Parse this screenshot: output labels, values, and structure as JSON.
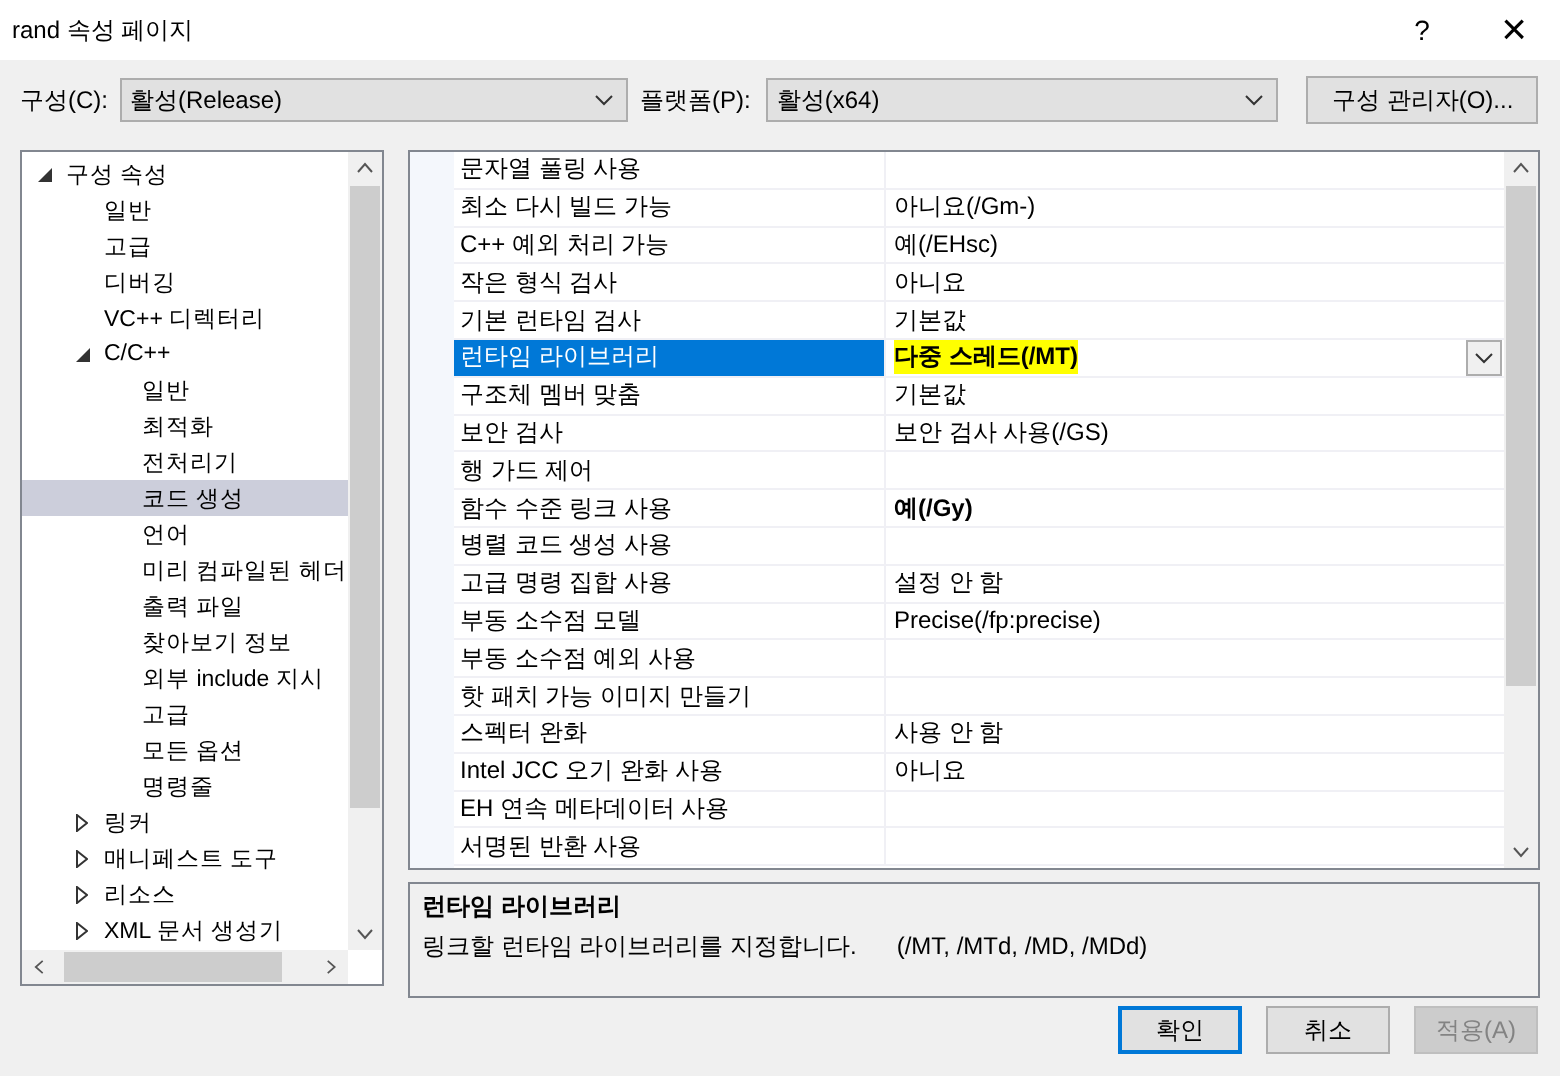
{
  "window": {
    "title": "rand 속성 페이지",
    "help": "?",
    "close": "×"
  },
  "toolbar": {
    "config_label": "구성(C):",
    "config_value": "활성(Release)",
    "platform_label": "플랫폼(P):",
    "platform_value": "활성(x64)",
    "manager_button": "구성 관리자(O)..."
  },
  "tree": [
    {
      "label": "구성 속성",
      "expanded": true,
      "selected": false,
      "children": [
        {
          "label": "일반",
          "selected": false
        },
        {
          "label": "고급",
          "selected": false
        },
        {
          "label": "디버깅",
          "selected": false
        },
        {
          "label": "VC++ 디렉터리",
          "selected": false
        },
        {
          "label": "C/C++",
          "expanded": true,
          "selected": false,
          "children": [
            {
              "label": "일반",
              "selected": false
            },
            {
              "label": "최적화",
              "selected": false
            },
            {
              "label": "전처리기",
              "selected": false
            },
            {
              "label": "코드 생성",
              "selected": true
            },
            {
              "label": "언어",
              "selected": false
            },
            {
              "label": "미리 컴파일된 헤더",
              "selected": false
            },
            {
              "label": "출력 파일",
              "selected": false
            },
            {
              "label": "찾아보기 정보",
              "selected": false
            },
            {
              "label": "외부 include 지시",
              "selected": false
            },
            {
              "label": "고급",
              "selected": false
            },
            {
              "label": "모든 옵션",
              "selected": false
            },
            {
              "label": "명령줄",
              "selected": false
            }
          ]
        },
        {
          "label": "링커",
          "expanded": false,
          "selected": false
        },
        {
          "label": "매니페스트 도구",
          "expanded": false,
          "selected": false
        },
        {
          "label": "리소스",
          "expanded": false,
          "selected": false
        },
        {
          "label": "XML 문서 생성기",
          "expanded": false,
          "selected": false
        }
      ]
    }
  ],
  "properties": [
    {
      "name": "문자열 풀링 사용",
      "selected": false
    },
    {
      "name": "최소 다시 빌드 가능",
      "value": "아니요(/Gm-)",
      "selected": false,
      "modified": false
    },
    {
      "name": "C++ 예외 처리 가능",
      "value": "예(/EHsc)",
      "selected": false,
      "modified": false
    },
    {
      "name": "작은 형식 검사",
      "value": "아니요",
      "selected": false,
      "modified": false
    },
    {
      "name": "기본 런타임 검사",
      "value": "기본값",
      "selected": false,
      "modified": false
    },
    {
      "name": "런타임 라이브러리",
      "value": "다중 스레드(/MT)",
      "selected": true,
      "modified": true,
      "highlighted": true
    },
    {
      "name": "구조체 멤버 맞춤",
      "value": "기본값",
      "selected": false,
      "modified": false
    },
    {
      "name": "보안 검사",
      "value": "보안 검사 사용(/GS)",
      "selected": false,
      "modified": false
    },
    {
      "name": "행 가드 제어",
      "selected": false
    },
    {
      "name": "함수 수준 링크 사용",
      "value": "예(/Gy)",
      "selected": false,
      "modified": true
    },
    {
      "name": "병렬 코드 생성 사용",
      "selected": false
    },
    {
      "name": "고급 명령 집합 사용",
      "value": "설정 안 함",
      "selected": false,
      "modified": false
    },
    {
      "name": "부동 소수점 모델",
      "value": "Precise(/fp:precise)",
      "selected": false,
      "modified": false
    },
    {
      "name": "부동 소수점 예외 사용",
      "selected": false
    },
    {
      "name": "핫 패치 가능 이미지 만들기",
      "selected": false
    },
    {
      "name": "스펙터 완화",
      "value": "사용 안 함",
      "selected": false,
      "modified": false
    },
    {
      "name": "Intel JCC 오기 완화 사용",
      "value": "아니요",
      "selected": false,
      "modified": false
    },
    {
      "name": "EH 연속 메타데이터 사용",
      "selected": false
    },
    {
      "name": "서명된 반환 사용",
      "selected": false
    }
  ],
  "description": {
    "title": "런타임 라이브러리",
    "text": "링크할 런타임 라이브러리를 지정합니다.",
    "options": "(/MT, /MTd, /MD, /MDd)"
  },
  "buttons": [
    {
      "label": "확인",
      "kind": "primary",
      "disabled": false
    },
    {
      "label": "취소",
      "kind": "normal",
      "disabled": false
    },
    {
      "label": "적용(A)",
      "kind": "normal",
      "disabled": true
    }
  ]
}
